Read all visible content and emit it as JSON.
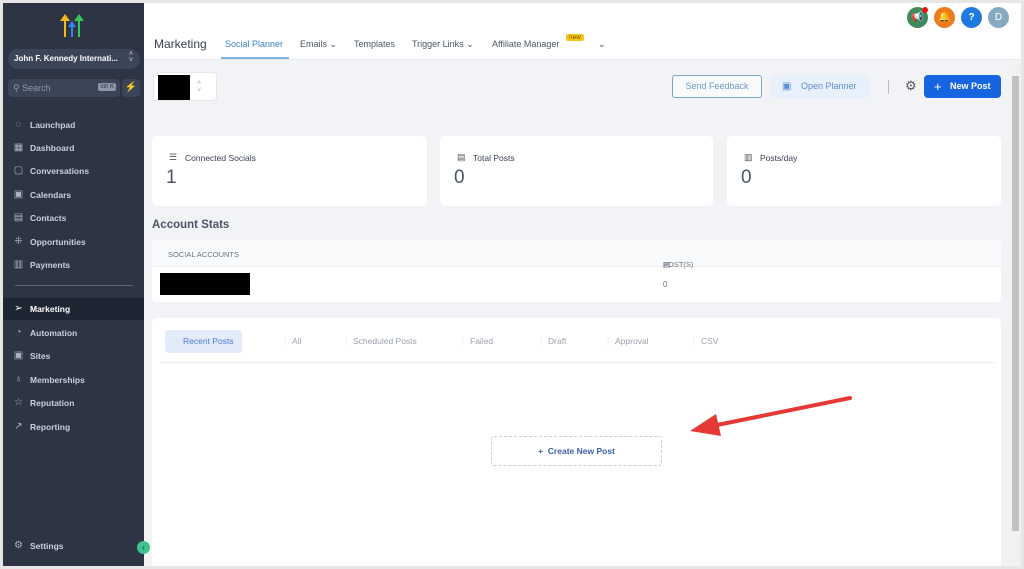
{
  "sidebar": {
    "location": "John F. Kennedy Internati...",
    "search_placeholder": "Search",
    "shortcut": "ctrl K",
    "items": [
      {
        "label": "Launchpad",
        "icon": "rocket-icon"
      },
      {
        "label": "Dashboard",
        "icon": "grid-icon"
      },
      {
        "label": "Conversations",
        "icon": "chat-icon"
      },
      {
        "label": "Calendars",
        "icon": "calendar-icon"
      },
      {
        "label": "Contacts",
        "icon": "contacts-icon"
      },
      {
        "label": "Opportunities",
        "icon": "opportunities-icon"
      },
      {
        "label": "Payments",
        "icon": "payments-icon"
      },
      {
        "label": "Marketing",
        "icon": "send-icon"
      },
      {
        "label": "Automation",
        "icon": "play-icon"
      },
      {
        "label": "Sites",
        "icon": "sites-icon"
      },
      {
        "label": "Memberships",
        "icon": "award-icon"
      },
      {
        "label": "Reputation",
        "icon": "star-icon"
      },
      {
        "label": "Reporting",
        "icon": "trend-icon"
      }
    ],
    "settings": "Settings"
  },
  "header": {
    "title": "Marketing",
    "tabs": [
      "Social Planner",
      "Emails",
      "Templates",
      "Trigger Links",
      "Affiliate Manager"
    ],
    "new_badge": "new",
    "avatar": "D"
  },
  "toolbar": {
    "send_feedback": "Send Feedback",
    "open_planner": "Open Planner",
    "new_post": "New Post"
  },
  "stats": [
    {
      "label": "Connected Socials",
      "value": "1"
    },
    {
      "label": "Total Posts",
      "value": "0"
    },
    {
      "label": "Posts/day",
      "value": "0"
    }
  ],
  "account_stats": {
    "title": "Account Stats",
    "col1": "SOCIAL ACCOUNTS",
    "col2": "POST(S)",
    "rows": [
      {
        "posts": "0"
      }
    ]
  },
  "post_tabs": [
    "Recent Posts",
    "All",
    "Scheduled Posts",
    "Failed",
    "Draft",
    "Approval",
    "CSV"
  ],
  "create_post": "Create New Post",
  "colors": {
    "sidebar": "#2d3544",
    "primary": "#1764e0",
    "annotation_arrow": "#e53935"
  }
}
